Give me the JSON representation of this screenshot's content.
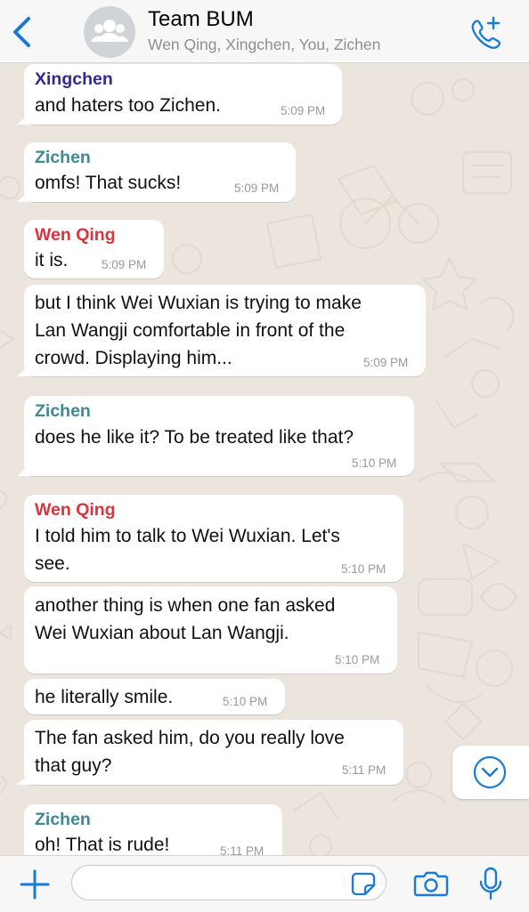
{
  "header": {
    "title": "Team BUM",
    "members": "Wen Qing, Xingchen, You, Zichen",
    "icons": {
      "back": "chevron-left-icon",
      "avatar": "group-icon",
      "call": "phone-add-icon"
    }
  },
  "messages": [
    {
      "sender": "Xingchen",
      "lines": [
        "and haters too Zichen."
      ],
      "time": "5:09 PM"
    },
    {
      "sender": "Zichen",
      "lines": [
        "omfs! That sucks!"
      ],
      "time": "5:09 PM"
    },
    {
      "sender": "Wen Qing",
      "lines": [
        "it is."
      ],
      "time": "5:09 PM"
    },
    {
      "lines": [
        "but I think Wei Wuxian is trying to make",
        "Lan Wangji comfortable in front of the",
        "crowd. Displaying him..."
      ],
      "time": "5:09 PM"
    },
    {
      "sender": "Zichen",
      "lines": [
        "does he like it? To be treated like that?"
      ],
      "time": "5:10 PM"
    },
    {
      "sender": "Wen Qing",
      "lines": [
        "I told him to talk to Wei Wuxian. Let's",
        "see."
      ],
      "time": "5:10 PM"
    },
    {
      "lines": [
        "another thing is when one fan asked",
        "Wei Wuxian about Lan Wangji."
      ],
      "time": "5:10 PM"
    },
    {
      "lines": [
        "he literally smile."
      ],
      "time": "5:10 PM"
    },
    {
      "lines": [
        "The fan asked him, do you really love",
        "that guy?"
      ],
      "time": "5:11 PM"
    },
    {
      "sender": "Zichen",
      "lines": [
        "oh! That is rude!"
      ],
      "time": "5:11 PM"
    }
  ],
  "input_bar": {
    "placeholder": "",
    "icons": {
      "attach": "plus-icon",
      "sticker": "sticker-icon",
      "camera": "camera-icon",
      "mic": "microphone-icon"
    }
  },
  "colors": {
    "accent": "#1a7ad6",
    "sender_xingchen": "#312a91",
    "sender_zichen": "#3f8a92",
    "sender_wen_qing": "#d8353c",
    "chat_background": "#ece5dd",
    "bubble": "#ffffff",
    "timestamp": "#9a9a9a"
  }
}
